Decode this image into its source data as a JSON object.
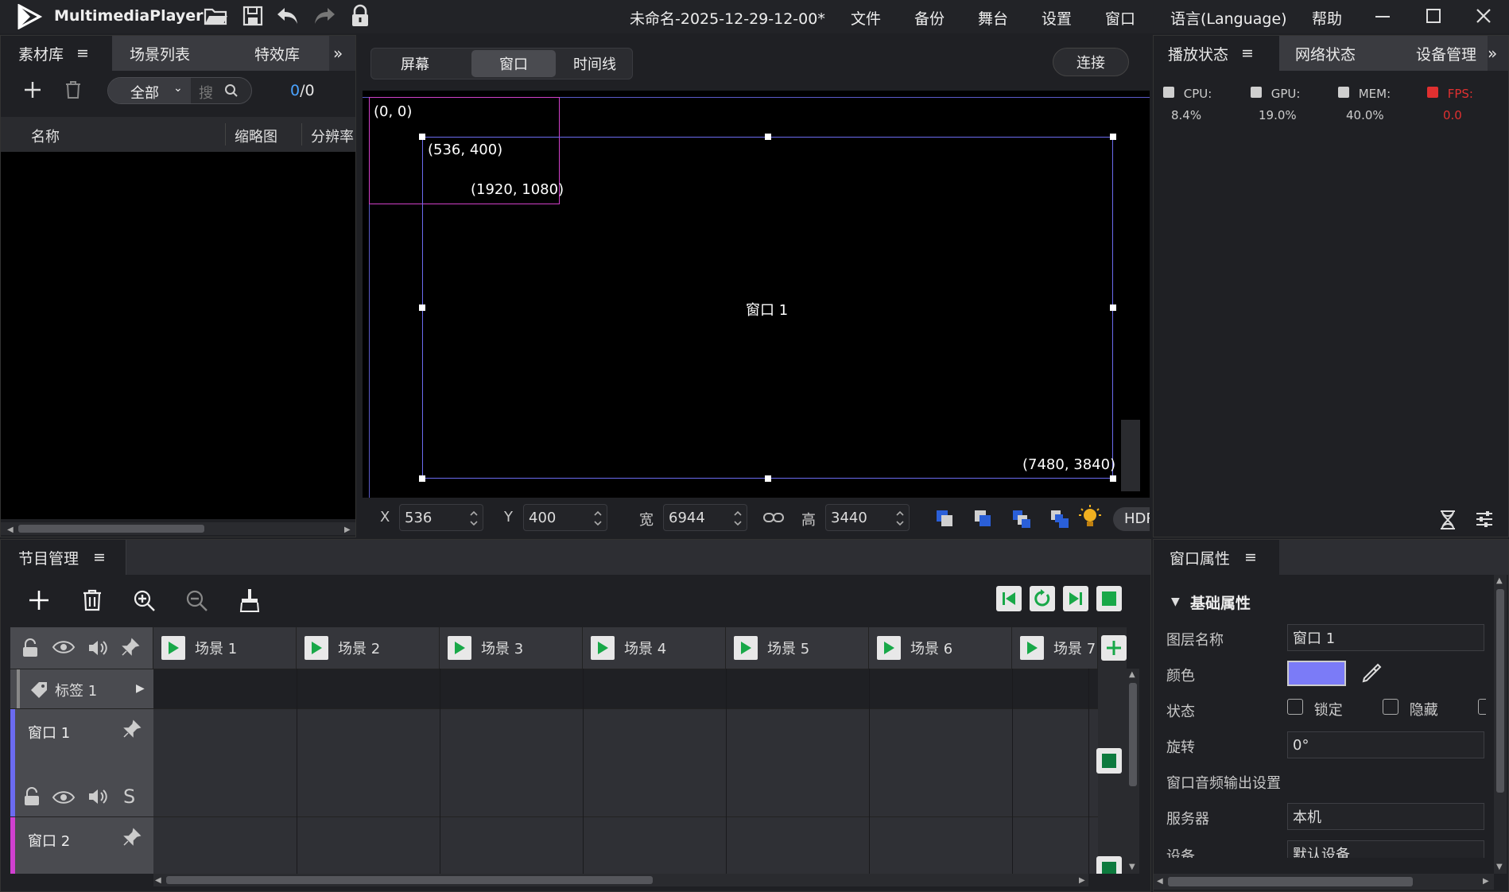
{
  "app": {
    "name": "MultimediaPlayer",
    "doc_title": "未命名-2025-12-29-12-00*",
    "menus": [
      "文件",
      "备份",
      "舞台",
      "设置",
      "窗口",
      "语言(Language)",
      "帮助"
    ]
  },
  "left_panel": {
    "tabs": [
      "素材库",
      "场景列表",
      "特效库"
    ],
    "filter": "全部",
    "search_placeholder": "搜",
    "count_current": "0",
    "count_total": "/0",
    "columns": [
      "名称",
      "缩略图",
      "分辨率"
    ]
  },
  "center": {
    "view_tabs": [
      "屏幕",
      "窗口",
      "时间线"
    ],
    "active_view": "窗口",
    "connect_label": "连接",
    "screen_origin_label": "(0, 0)",
    "screen_end_label": "(1920, 1080)",
    "window_origin_label": "(536, 400)",
    "window_end_label": "(7480, 3840)",
    "window_name": "窗口 1",
    "fields": {
      "x_label": "X",
      "x": "536",
      "y_label": "Y",
      "y": "400",
      "w_label": "宽",
      "w": "6944",
      "h_label": "高",
      "h": "3440"
    },
    "hdr_label": "HDR"
  },
  "right_panel": {
    "tabs": [
      "播放状态",
      "网络状态",
      "设备管理"
    ],
    "stats": [
      {
        "label": "CPU:",
        "value": "8.4%",
        "color": "#cfcfcf"
      },
      {
        "label": "GPU:",
        "value": "19.0%",
        "color": "#cfcfcf"
      },
      {
        "label": "MEM:",
        "value": "40.0%",
        "color": "#cfcfcf"
      },
      {
        "label": "FPS:",
        "value": "0.0",
        "color": "#e03030"
      }
    ]
  },
  "program": {
    "tab": "节目管理",
    "scenes": [
      "场景 1",
      "场景 2",
      "场景 3",
      "场景 4",
      "场景 5",
      "场景 6",
      "场景 7"
    ],
    "tag_label": "标签 1",
    "layers": [
      {
        "name": "窗口 1",
        "color": "#6b6bf0"
      },
      {
        "name": "窗口 2",
        "color": "#d040d0"
      }
    ]
  },
  "properties": {
    "tab": "窗口属性",
    "section": "基础属性",
    "layer_name_label": "图层名称",
    "layer_name": "窗口 1",
    "color_label": "颜色",
    "color_value": "#7b7bf7",
    "state_label": "状态",
    "lock_label": "锁定",
    "hide_label": "隐藏",
    "rotation_label": "旋转",
    "rotation": "0°",
    "audio_section": "窗口音频输出设置",
    "server_label": "服务器",
    "server": "本机",
    "device_label": "设备",
    "device": "默认设备"
  }
}
